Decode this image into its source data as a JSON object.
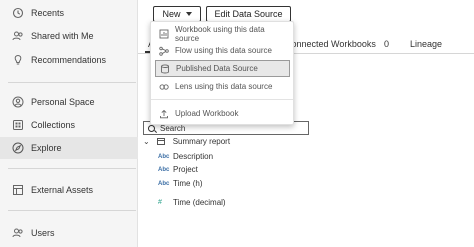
{
  "sidebar": {
    "items": [
      {
        "label": "Recents",
        "icon": "history-icon"
      },
      {
        "label": "Shared with Me",
        "icon": "shared-users-icon"
      },
      {
        "label": "Recommendations",
        "icon": "lightbulb-icon"
      },
      {
        "label": "Personal Space",
        "icon": "person-icon"
      },
      {
        "label": "Collections",
        "icon": "collections-icon"
      },
      {
        "label": "Explore",
        "icon": "compass-icon",
        "active": true
      },
      {
        "label": "External Assets",
        "icon": "external-assets-icon"
      },
      {
        "label": "Users",
        "icon": "users-icon"
      }
    ]
  },
  "toolbar": {
    "new_label": "New",
    "edit_data_source_label": "Edit Data Source"
  },
  "tabs": {
    "first_partial": "A",
    "connected_workbooks": "Connected Workbooks",
    "connected_workbooks_count": "0",
    "lineage": "Lineage"
  },
  "new_menu": {
    "items": [
      {
        "label": "Workbook using this data source",
        "icon": "workbook-icon"
      },
      {
        "label": "Flow using this data source",
        "icon": "flow-icon"
      },
      {
        "label": "Published Data Source",
        "icon": "data-source-icon",
        "highlighted": true
      },
      {
        "label": "Lens using this data source",
        "icon": "lens-icon"
      },
      {
        "label": "Upload Workbook",
        "icon": "upload-icon"
      }
    ]
  },
  "search": {
    "placeholder": "Search"
  },
  "tree": {
    "root_label": "Summary report",
    "fields": [
      {
        "type": "Abc",
        "label": "Description"
      },
      {
        "type": "Abc",
        "label": "Project"
      },
      {
        "type": "Abc",
        "label": "Time (h)"
      },
      {
        "type": "#",
        "label": "Time (decimal)"
      }
    ]
  }
}
